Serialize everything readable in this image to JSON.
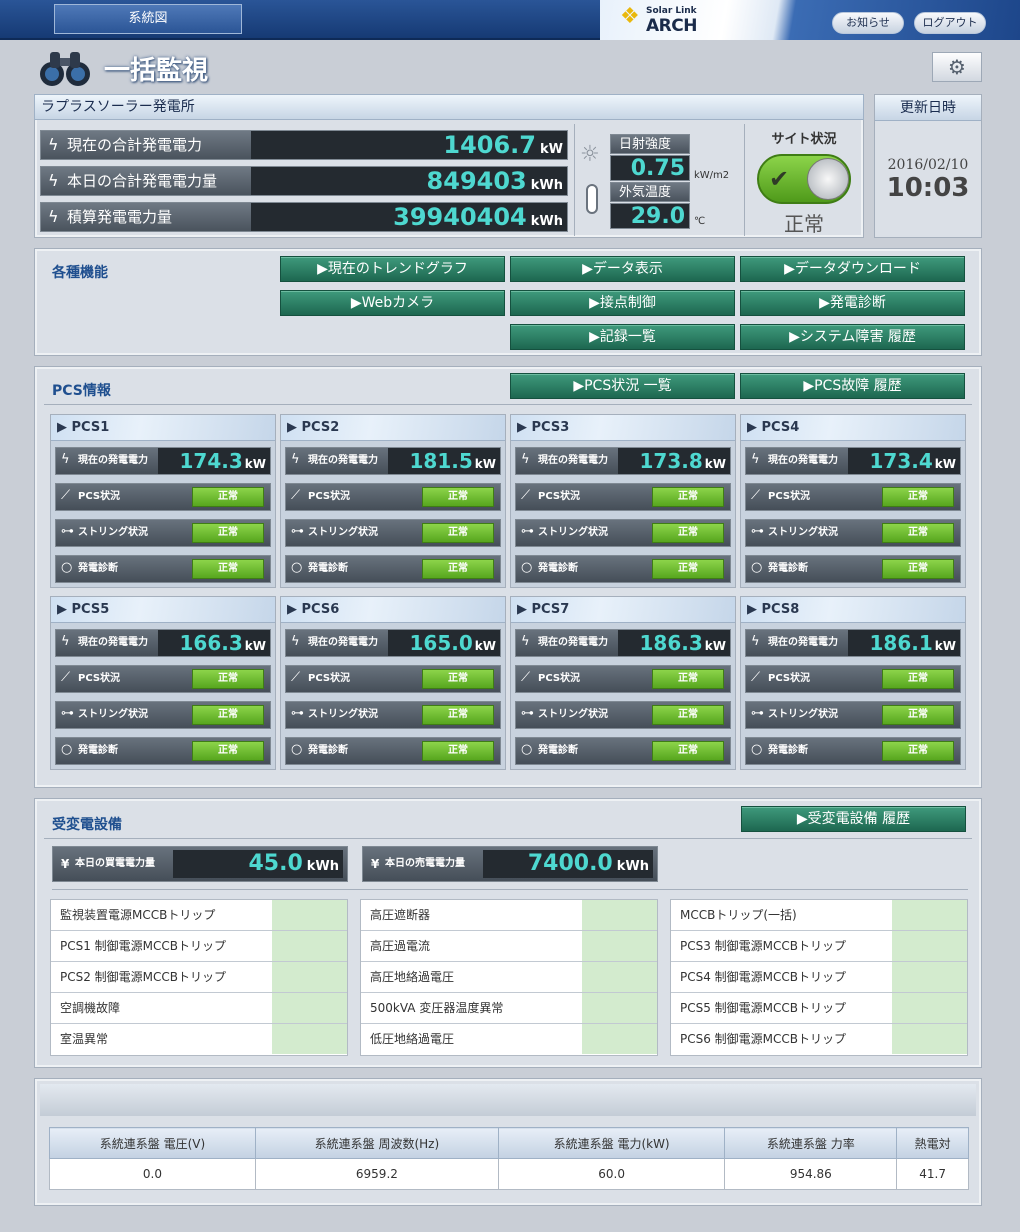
{
  "header": {
    "tab_label": "系統図",
    "logo_small": "Solar Link",
    "logo_big": "ARCH",
    "notice_label": "お知らせ",
    "logout_label": "ログアウト"
  },
  "page": {
    "title": "一括監視"
  },
  "plant": {
    "name": "ラプラスソーラー発電所",
    "rows": [
      {
        "label": "現在の合計発電電力",
        "value": "1406.7",
        "unit": "kW"
      },
      {
        "label": "本日の合計発電電力量",
        "value": "849403",
        "unit": "kWh"
      },
      {
        "label": "積算発電電力量",
        "value": "39940404",
        "unit": "kWh"
      }
    ],
    "irradiance": {
      "label": "日射強度",
      "value": "0.75",
      "unit": "kW/m2"
    },
    "temperature": {
      "label": "外気温度",
      "value": "29.0",
      "unit": "℃"
    },
    "site_status": {
      "title": "サイト状況",
      "value": "正常"
    }
  },
  "update": {
    "title": "更新日時",
    "date": "2016/02/10",
    "time": "10:03"
  },
  "functions": {
    "title": "各種機能",
    "buttons": [
      "▶現在のトレンドグラフ",
      "▶データ表示",
      "▶データダウンロード",
      "▶Webカメラ",
      "▶接点制御",
      "▶発電診断",
      "▶記録一覧",
      "▶システム障害 履歴"
    ]
  },
  "pcs": {
    "title": "PCS情報",
    "list_button": "▶PCS状況 一覧",
    "fault_button": "▶PCS故障 履歴",
    "power_label": "現在の発電電力",
    "status_label": "PCS状況",
    "string_label": "ストリング状況",
    "diag_label": "発電診断",
    "unit": "kW",
    "ok": "正常",
    "items": [
      {
        "name": "▶ PCS1",
        "power": "174.3"
      },
      {
        "name": "▶ PCS2",
        "power": "181.5"
      },
      {
        "name": "▶ PCS3",
        "power": "173.8"
      },
      {
        "name": "▶ PCS4",
        "power": "173.4"
      },
      {
        "name": "▶ PCS5",
        "power": "166.3"
      },
      {
        "name": "▶ PCS6",
        "power": "165.0"
      },
      {
        "name": "▶ PCS7",
        "power": "186.3"
      },
      {
        "name": "▶ PCS8",
        "power": "186.1"
      }
    ]
  },
  "substation": {
    "title": "受変電設備",
    "history_button": "▶受変電設備 履歴",
    "buy": {
      "label": "本日の買電電力量",
      "value": "45.0",
      "unit": "kWh"
    },
    "sell": {
      "label": "本日の売電電力量",
      "value": "7400.0",
      "unit": "kWh"
    },
    "alarms": [
      [
        "監視装置電源MCCBトリップ",
        "PCS1 制御電源MCCBトリップ",
        "PCS2 制御電源MCCBトリップ",
        "空調機故障",
        "室温異常"
      ],
      [
        "高圧遮断器",
        "高圧過電流",
        "高圧地絡過電圧",
        "500kVA 変圧器温度異常",
        "低圧地絡過電圧"
      ],
      [
        "MCCBトリップ(一括)",
        "PCS3 制御電源MCCBトリップ",
        "PCS4 制御電源MCCBトリップ",
        "PCS5 制御電源MCCBトリップ",
        "PCS6 制御電源MCCBトリップ"
      ]
    ]
  },
  "grid": {
    "headers": [
      "系統連系盤 電圧(V)",
      "系統連系盤 周波数(Hz)",
      "系統連系盤 電力(kW)",
      "系統連系盤 力率",
      "熱電対"
    ],
    "values": [
      "0.0",
      "6959.2",
      "60.0",
      "954.86",
      "41.7"
    ]
  }
}
